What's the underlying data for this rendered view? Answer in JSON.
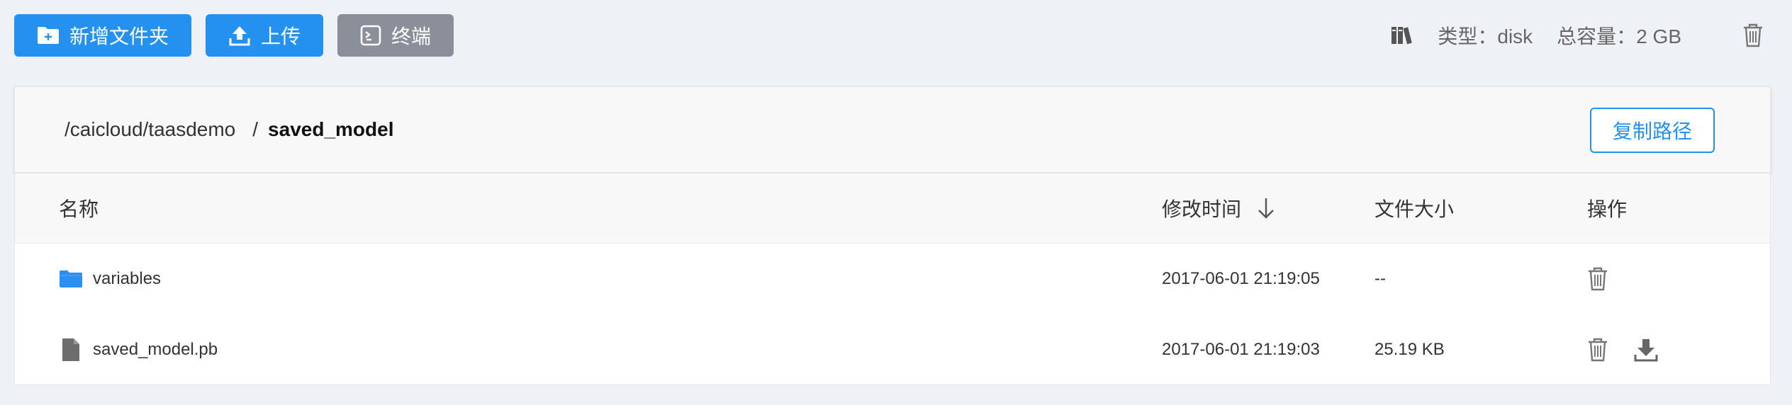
{
  "toolbar": {
    "new_folder_label": "新增文件夹",
    "upload_label": "上传",
    "terminal_label": "终端"
  },
  "storage": {
    "type_label": "类型：",
    "type_value": "disk",
    "capacity_label": "总容量：",
    "capacity_value": "2 GB"
  },
  "breadcrumb": {
    "parent_path": "/caicloud/taasdemo",
    "separator": "/",
    "current": "saved_model"
  },
  "copy_path_label": "复制路径",
  "table": {
    "columns": {
      "name": "名称",
      "modified": "修改时间",
      "size": "文件大小",
      "ops": "操作"
    },
    "rows": [
      {
        "type": "folder",
        "name": "variables",
        "modified": "2017-06-01 21:19:05",
        "size": "--"
      },
      {
        "type": "file",
        "name": "saved_model.pb",
        "modified": "2017-06-01 21:19:03",
        "size": "25.19 KB"
      }
    ]
  },
  "icons": {
    "new_folder": "folder-plus-icon",
    "upload": "upload-icon",
    "terminal": "terminal-icon",
    "library": "books-icon",
    "trash": "trash-icon",
    "sort": "arrow-down-icon",
    "folder": "folder-icon",
    "file": "file-icon",
    "download": "download-icon"
  },
  "colors": {
    "primary": "#2491f0",
    "gray_button": "#8a8f99",
    "background": "#eef2f7",
    "folder": "#2a8ff0",
    "file": "#6d6d6d"
  }
}
